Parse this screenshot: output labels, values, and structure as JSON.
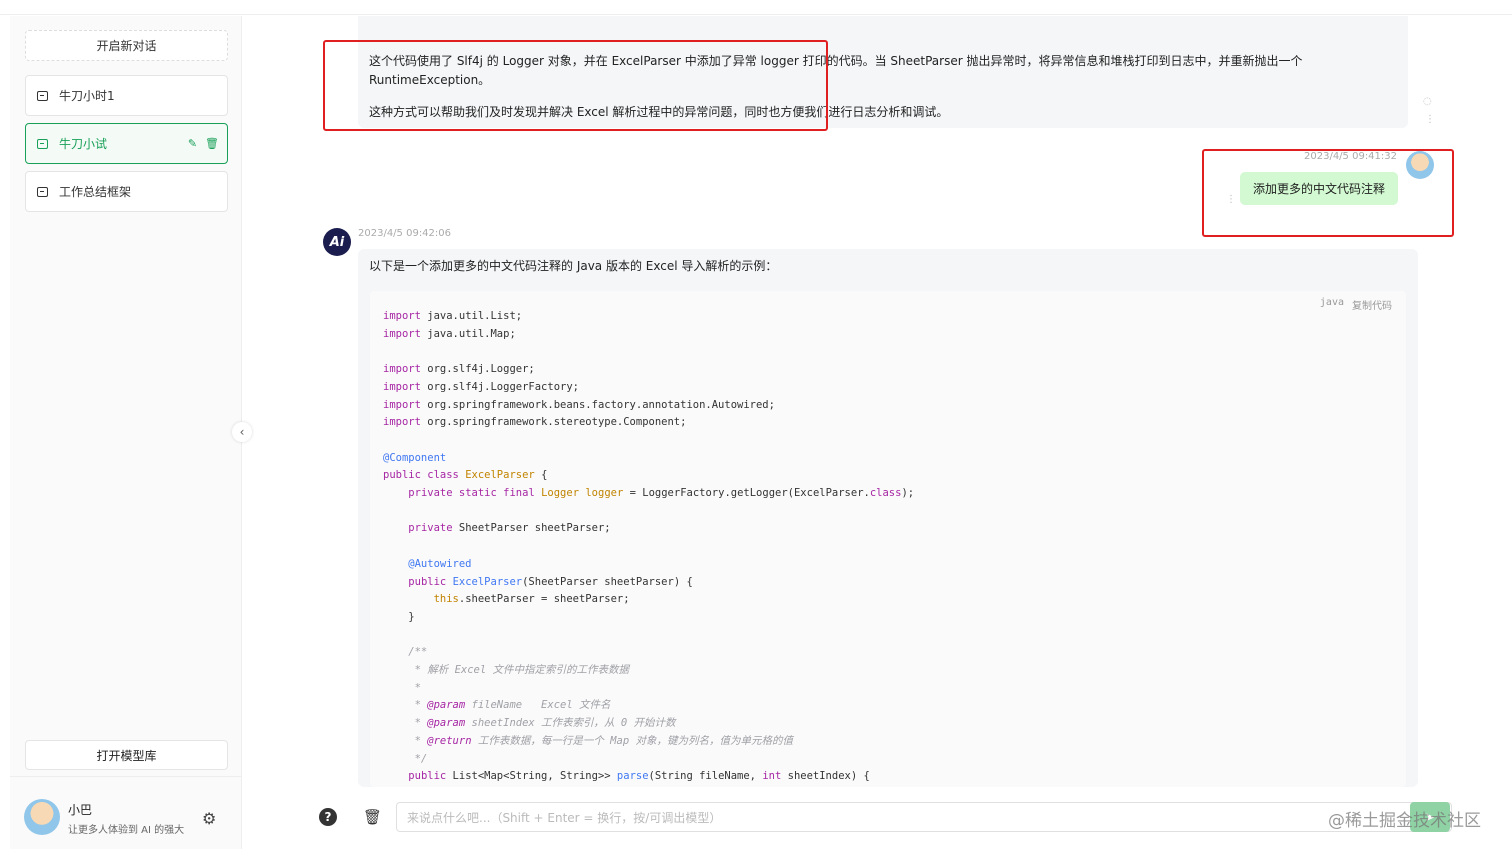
{
  "sidebar": {
    "new_chat": "开启新对话",
    "conversations": [
      "牛刀小时1",
      "牛刀小试",
      "工作总结框架"
    ],
    "active_index": 1,
    "open_model_library": "打开模型库",
    "user": {
      "name": "小巴",
      "subtitle": "让更多人体验到 AI 的强大"
    }
  },
  "messages": {
    "prev_ai": {
      "para1_line1": "这个代码使用了 Slf4j 的 Logger 对象，并在 ExcelParser 中添加了异常 logger 打印的代码。当 SheetParser 抛出异常时，将异常信息和堆栈打印到日志中，并重新抛出一个",
      "para1_line2": "RuntimeException。",
      "para2": "这种方式可以帮助我们及时发现并解决 Excel 解析过程中的异常问题，同时也方便我们进行日志分析和调试。"
    },
    "user": {
      "time": "2023/4/5 09:41:32",
      "text": "添加更多的中文代码注释"
    },
    "ai": {
      "time": "2023/4/5 09:42:06",
      "avatar_text": "Ai",
      "intro": "以下是一个添加更多的中文代码注释的 Java 版本的 Excel 导入解析的示例：",
      "code_lang": "java",
      "copy_label": "复制代码",
      "code_lines": [
        "import java.util.List;",
        "import java.util.Map;",
        "",
        "import org.slf4j.Logger;",
        "import org.slf4j.LoggerFactory;",
        "import org.springframework.beans.factory.annotation.Autowired;",
        "import org.springframework.stereotype.Component;",
        "",
        "@Component",
        "public class ExcelParser {",
        "    private static final Logger logger = LoggerFactory.getLogger(ExcelParser.class);",
        "",
        "    private SheetParser sheetParser;",
        "",
        "    @Autowired",
        "    public ExcelParser(SheetParser sheetParser) {",
        "        this.sheetParser = sheetParser;",
        "    }",
        "",
        "    /**",
        "     * 解析 Excel 文件中指定索引的工作表数据",
        "     *",
        "     * @param fileName   Excel 文件名",
        "     * @param sheetIndex 工作表索引，从 0 开始计数",
        "     * @return 工作表数据，每一行是一个 Map 对象，键为列名，值为单元格的值",
        "     */",
        "    public List<Map<String, String>> parse(String fileName, int sheetIndex) {"
      ]
    }
  },
  "input": {
    "placeholder": "来说点什么吧...（Shift + Enter = 换行，按/可调出模型）"
  },
  "watermark": "@稀土掘金技术社区",
  "colors": {
    "accent": "#18a058",
    "user_bubble": "#d2f9d1",
    "highlight": "#e02020"
  }
}
